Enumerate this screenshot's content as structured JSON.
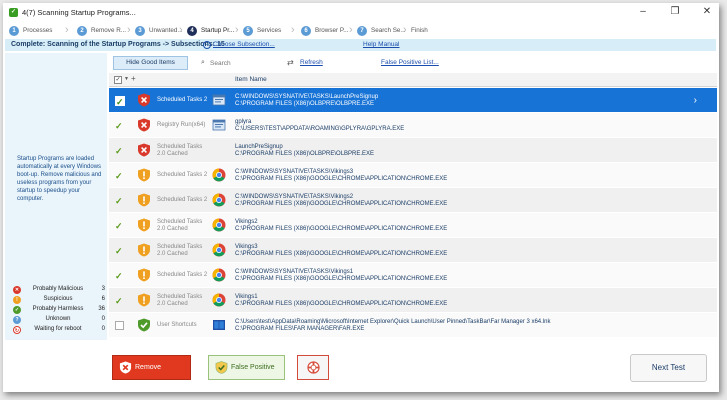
{
  "window": {
    "title": "4(7) Scanning Startup Programs...",
    "controls": {
      "minimize": "–",
      "maximize": "❐",
      "close": "✕"
    }
  },
  "steps": [
    {
      "num": "1",
      "label": "Processes"
    },
    {
      "num": "2",
      "label": "Remove R..."
    },
    {
      "num": "3",
      "label": "Unwanted..."
    },
    {
      "num": "4",
      "label": "Startup Pr...",
      "active": true
    },
    {
      "num": "5",
      "label": "Services"
    },
    {
      "num": "6",
      "label": "Browser P..."
    },
    {
      "num": "7",
      "label": "Search Se..."
    },
    {
      "num": "",
      "label": "Finish"
    }
  ],
  "status": {
    "text": "Complete: Scanning of the Startup Programs -> Subsections: 15",
    "choose_link": "Choose Subsection...",
    "help_link": "Help Manual"
  },
  "left_panel": {
    "description": "Startup Programs are loaded automatically at every Windows boot-up. Remove malicious and useless programs from your startup to speedup your computer.",
    "legend": [
      {
        "label": "Probably Malicious",
        "count": "3",
        "color": "#d9392a",
        "icon": "x-shield-icon"
      },
      {
        "label": "Suspicious",
        "count": "6",
        "color": "#f0a020",
        "icon": "exclamation-shield-icon"
      },
      {
        "label": "Probably Harmless",
        "count": "36",
        "color": "#4e9a2a",
        "icon": "check-shield-icon"
      },
      {
        "label": "Unknown",
        "count": "0",
        "color": "#5b9bd5",
        "icon": "question-shield-icon"
      },
      {
        "label": "Waiting for reboot",
        "count": "0",
        "color": "#d9392a",
        "icon": "reboot-icon"
      }
    ]
  },
  "toolbar": {
    "hide_good": "Hide Good Items",
    "search_placeholder": "Search",
    "refresh": "Refresh",
    "false_positive_list": "False Positive List..."
  },
  "list_header": {
    "item_name": "Item Name"
  },
  "rows": [
    {
      "status": "malicious",
      "type": "Scheduled Tasks 2",
      "app": "generic",
      "line1": "C:\\WINDOWS\\SYSNATIVE\\TASKS\\LaunchPreSignup",
      "line2": "C:\\PROGRAM FILES (X86)\\OLBPRE\\OLBPRE.EXE",
      "checked": true,
      "selected": true
    },
    {
      "status": "malicious",
      "type": "Registry Run(x64)",
      "app": "generic",
      "line1": "gplyra",
      "line2": "C:\\USERS\\TEST\\APPDATA\\ROAMING\\GPLYRA\\GPLYRA.EXE",
      "checked": true
    },
    {
      "status": "malicious",
      "type": "Scheduled Tasks\n2.0 Cached",
      "app": "none",
      "line1": "LaunchPreSignup",
      "line2": "C:\\PROGRAM FILES (X86)\\OLBPRE\\OLBPRE.EXE",
      "checked": true
    },
    {
      "status": "suspicious",
      "type": "Scheduled Tasks 2",
      "app": "chrome",
      "line1": "C:\\WINDOWS\\SYSNATIVE\\TASKS\\Vikings3",
      "line2": "C:\\PROGRAM FILES (X86)\\GOOGLE\\CHROME\\APPLICATION\\CHROME.EXE",
      "checked": true
    },
    {
      "status": "suspicious",
      "type": "Scheduled Tasks 2",
      "app": "chrome",
      "line1": "C:\\WINDOWS\\SYSNATIVE\\TASKS\\Vikings2",
      "line2": "C:\\PROGRAM FILES (X86)\\GOOGLE\\CHROME\\APPLICATION\\CHROME.EXE",
      "checked": true
    },
    {
      "status": "suspicious",
      "type": "Scheduled Tasks\n2.0 Cached",
      "app": "chrome",
      "line1": "Vikings2",
      "line2": "C:\\PROGRAM FILES (X86)\\GOOGLE\\CHROME\\APPLICATION\\CHROME.EXE",
      "checked": true
    },
    {
      "status": "suspicious",
      "type": "Scheduled Tasks\n2.0 Cached",
      "app": "chrome",
      "line1": "Vikings3",
      "line2": "C:\\PROGRAM FILES (X86)\\GOOGLE\\CHROME\\APPLICATION\\CHROME.EXE",
      "checked": true
    },
    {
      "status": "suspicious",
      "type": "Scheduled Tasks 2",
      "app": "chrome",
      "line1": "C:\\WINDOWS\\SYSNATIVE\\TASKS\\Vikings1",
      "line2": "C:\\PROGRAM FILES (X86)\\GOOGLE\\CHROME\\APPLICATION\\CHROME.EXE",
      "checked": true
    },
    {
      "status": "suspicious",
      "type": "Scheduled Tasks\n2.0 Cached",
      "app": "chrome",
      "line1": "Vikings1",
      "line2": "C:\\PROGRAM FILES (X86)\\GOOGLE\\CHROME\\APPLICATION\\CHROME.EXE",
      "checked": true
    },
    {
      "status": "harmless",
      "type": "User Shortcuts",
      "app": "farmanager",
      "line1": "C:\\Users\\test\\AppData\\Roaming\\Microsoft\\Internet Explorer\\Quick Launch\\User Pinned\\TaskBar\\Far Manager 3 x64.lnk",
      "line2": "C:\\PROGRAM FILES\\FAR MANAGER\\FAR.EXE",
      "checked": false
    }
  ],
  "buttons": {
    "remove_checked": "Remove Checked",
    "false_positive": "False Positive",
    "next_test": "Next Test"
  }
}
